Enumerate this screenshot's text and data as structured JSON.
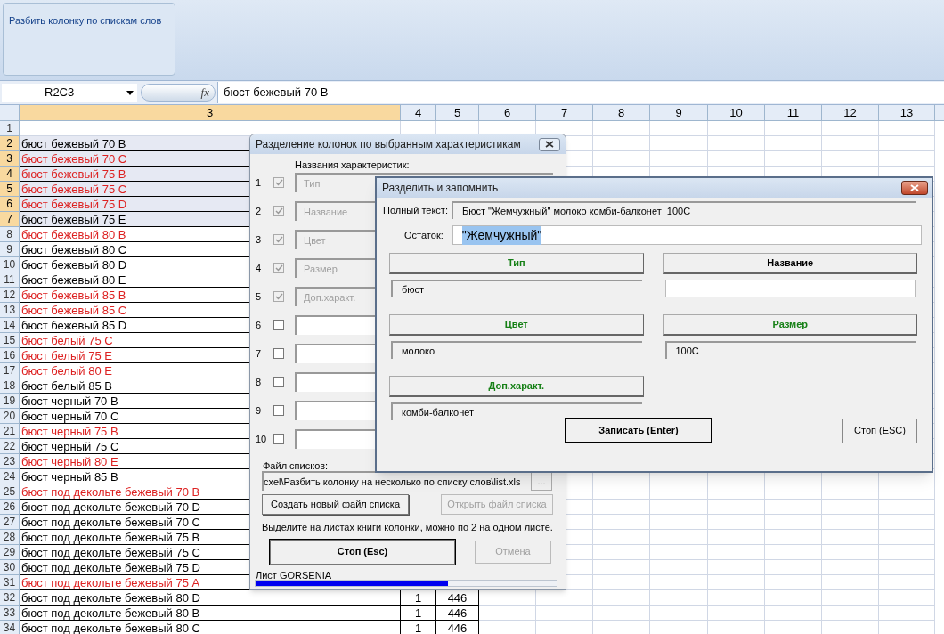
{
  "ribbon": {
    "group_label": "Разбить колонку по спискам слов"
  },
  "formula_bar": {
    "name_box": "R2C3",
    "fx_label": "fx",
    "formula": "бюст бежевый 70 B"
  },
  "sheet": {
    "columns": [
      {
        "label": "3",
        "selected": true
      },
      {
        "label": "4",
        "selected": false
      },
      {
        "label": "5",
        "selected": false
      },
      {
        "label": "6",
        "selected": false
      },
      {
        "label": "7",
        "selected": false
      },
      {
        "label": "8",
        "selected": false
      },
      {
        "label": "9",
        "selected": false
      },
      {
        "label": "10",
        "selected": false
      },
      {
        "label": "11",
        "selected": false
      },
      {
        "label": "12",
        "selected": false
      },
      {
        "label": "13",
        "selected": false
      }
    ],
    "rows": [
      {
        "number": "1",
        "selected": false
      },
      {
        "number": "2",
        "selected": true,
        "text": "бюст бежевый 70 B",
        "color": "#000000"
      },
      {
        "number": "3",
        "selected": true,
        "text": "бюст бежевый 70 C",
        "color": "#dd2222"
      },
      {
        "number": "4",
        "selected": true,
        "text": "бюст бежевый 75 B",
        "color": "#dd2222"
      },
      {
        "number": "5",
        "selected": true,
        "text": "бюст бежевый 75 C",
        "color": "#dd2222"
      },
      {
        "number": "6",
        "selected": true,
        "text": "бюст бежевый 75 D",
        "color": "#dd2222"
      },
      {
        "number": "7",
        "selected": true,
        "text": "бюст бежевый 75 E",
        "color": "#000000"
      },
      {
        "number": "8",
        "selected": false,
        "text": "бюст бежевый 80 B",
        "color": "#dd2222"
      },
      {
        "number": "9",
        "selected": false,
        "text": "бюст бежевый 80 C",
        "color": "#000000"
      },
      {
        "number": "10",
        "selected": false,
        "text": "бюст бежевый 80 D",
        "color": "#000000"
      },
      {
        "number": "11",
        "selected": false,
        "text": "бюст бежевый 80 E",
        "color": "#000000"
      },
      {
        "number": "12",
        "selected": false,
        "text": "бюст бежевый 85 B",
        "color": "#dd2222"
      },
      {
        "number": "13",
        "selected": false,
        "text": "бюст бежевый 85 C",
        "color": "#dd2222"
      },
      {
        "number": "14",
        "selected": false,
        "text": "бюст бежевый 85 D",
        "color": "#000000"
      },
      {
        "number": "15",
        "selected": false,
        "text": "бюст белый 75 C",
        "color": "#dd2222"
      },
      {
        "number": "16",
        "selected": false,
        "text": "бюст белый 75 E",
        "color": "#dd2222"
      },
      {
        "number": "17",
        "selected": false,
        "text": "бюст белый 80 E",
        "color": "#dd2222"
      },
      {
        "number": "18",
        "selected": false,
        "text": "бюст белый 85 B",
        "color": "#000000"
      },
      {
        "number": "19",
        "selected": false,
        "text": "бюст черный 70 B",
        "color": "#000000"
      },
      {
        "number": "20",
        "selected": false,
        "text": "бюст черный 70 C",
        "color": "#000000"
      },
      {
        "number": "21",
        "selected": false,
        "text": "бюст черный 75 B",
        "color": "#dd2222"
      },
      {
        "number": "22",
        "selected": false,
        "text": "бюст черный 75 C",
        "color": "#000000"
      },
      {
        "number": "23",
        "selected": false,
        "text": "бюст черный 80 E",
        "color": "#dd2222"
      },
      {
        "number": "24",
        "selected": false,
        "text": "бюст черный 85 B",
        "color": "#000000"
      },
      {
        "number": "25",
        "selected": false,
        "text": "бюст под декольте бежевый 70 B",
        "color": "#dd2222"
      },
      {
        "number": "26",
        "selected": false,
        "text": "бюст под декольте бежевый 70 D",
        "color": "#000000"
      },
      {
        "number": "27",
        "selected": false,
        "text": "бюст под декольте бежевый 70 C",
        "color": "#000000"
      },
      {
        "number": "28",
        "selected": false,
        "text": "бюст под декольте бежевый 75 B",
        "color": "#000000"
      },
      {
        "number": "29",
        "selected": false,
        "text": "бюст под декольте бежевый 75 C",
        "color": "#000000"
      },
      {
        "number": "30",
        "selected": false,
        "text": "бюст под декольте бежевый 75 D",
        "color": "#000000"
      },
      {
        "number": "31",
        "selected": false,
        "text": "бюст под декольте бежевый 75 A",
        "color": "#dd2222"
      },
      {
        "number": "32",
        "selected": false,
        "text": "бюст под декольте бежевый 80 D",
        "color": "#000000",
        "column_4": "1",
        "column_5": "446"
      },
      {
        "number": "33",
        "selected": false,
        "text": "бюст под декольте бежевый 80 B",
        "color": "#000000",
        "column_4": "1",
        "column_5": "446"
      },
      {
        "number": "34",
        "selected": false,
        "text": "бюст под декольте бежевый 80 C",
        "color": "#000000",
        "column_4": "1",
        "column_5": "446"
      }
    ]
  },
  "split_dialog": {
    "title": "Разделение колонок по выбранным характеристикам",
    "heading": "Названия характеристик:",
    "items": [
      {
        "index": "1",
        "checked": true,
        "disabled": true,
        "value": "Тип"
      },
      {
        "index": "2",
        "checked": true,
        "disabled": true,
        "value": "Название"
      },
      {
        "index": "3",
        "checked": true,
        "disabled": true,
        "value": "Цвет"
      },
      {
        "index": "4",
        "checked": true,
        "disabled": true,
        "value": "Размер"
      },
      {
        "index": "5",
        "checked": true,
        "disabled": true,
        "value": "Доп.характ."
      },
      {
        "index": "6",
        "checked": false,
        "disabled": false
      },
      {
        "index": "7",
        "checked": false,
        "disabled": false
      },
      {
        "index": "8",
        "checked": false,
        "disabled": false
      },
      {
        "index": "9",
        "checked": false,
        "disabled": false
      },
      {
        "index": "10",
        "checked": false,
        "disabled": false
      }
    ],
    "file_label": "Файл списков:",
    "file_path": "cxel\\Разбить колонку на несколько по списку слов\\list.xls",
    "browse_button": "...",
    "create_button": {
      "label": "Создать новый файл списка",
      "disabled": false
    },
    "open_button": {
      "label": "Открыть файл списка",
      "disabled": true
    },
    "hint": "Выделите на листах книги колонки, можно по 2 на одном листе.",
    "stop_button": {
      "label": "Стоп (Esc)",
      "disabled": false
    },
    "cancel_button": {
      "label": "Отмена",
      "disabled": true
    },
    "status": "Лист GORSENIA",
    "progress": {
      "level": 0.64
    }
  },
  "remember_dialog": {
    "title": "Разделить и запомнить",
    "full_text_label": "Полный текст:",
    "full_text": "Бюст \"Жемчужный\" молоко комби-балконет  100C",
    "remainder_label": "Остаток:",
    "remainder": "\"Жемчужный\"",
    "fields": [
      {
        "label": "Тип",
        "matched": true,
        "value": "бюст"
      },
      {
        "label": "Название",
        "matched": false
      },
      {
        "label": "Цвет",
        "matched": true,
        "value": "молоко"
      },
      {
        "label": "Размер",
        "matched": true,
        "value": "100C"
      },
      {
        "label": "Доп.характ.",
        "matched": true,
        "value": "комби-балконет"
      }
    ],
    "save_button": "Записать (Enter)",
    "stop_button": "Стоп (ESC)"
  }
}
